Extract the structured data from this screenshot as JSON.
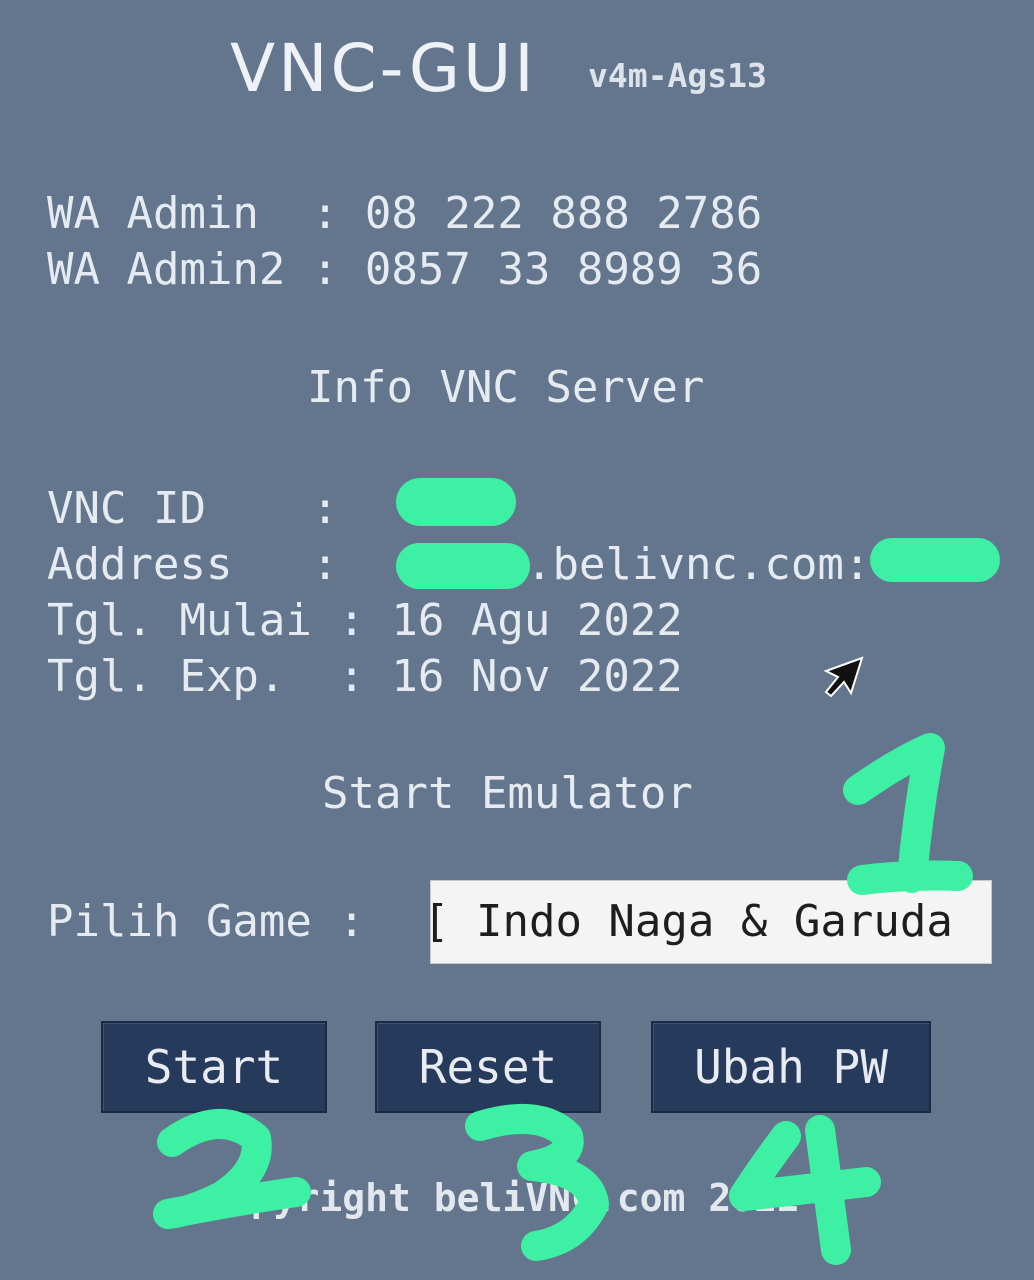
{
  "app": {
    "title": "VNC-GUI",
    "version": "v4m-Ags13"
  },
  "contacts": [
    {
      "label": "WA Admin  ",
      "sep": ":",
      "value": "08 222 888 2786"
    },
    {
      "label": "WA Admin2 ",
      "sep": ":",
      "value": "0857 33 8989 36"
    }
  ],
  "server_info": {
    "heading": "Info VNC Server",
    "vnc_id_label": "VNC ID    ",
    "address_label": "Address   ",
    "address_visible": ".belivnc.com:",
    "start_label": "Tgl. Mulai",
    "start_value": "16 Agu 2022",
    "exp_label": "Tgl. Exp. ",
    "exp_value": "16 Nov 2022",
    "sep": ":"
  },
  "emulator": {
    "heading": "Start Emulator",
    "game_label": "Pilih Game :",
    "game_value": "[ Indo Naga & Garuda"
  },
  "buttons": {
    "start": "Start",
    "reset": "Reset",
    "change_pw": "Ubah PW"
  },
  "footer": {
    "copyright": "Copyright beliVNC.com 2022"
  },
  "annotations": {
    "color": "#3ef0a3",
    "marks": [
      "1",
      "2",
      "3",
      "4"
    ]
  },
  "colors": {
    "background": "#64768e",
    "button": "#263a5b",
    "annotation": "#3ef0a3"
  }
}
